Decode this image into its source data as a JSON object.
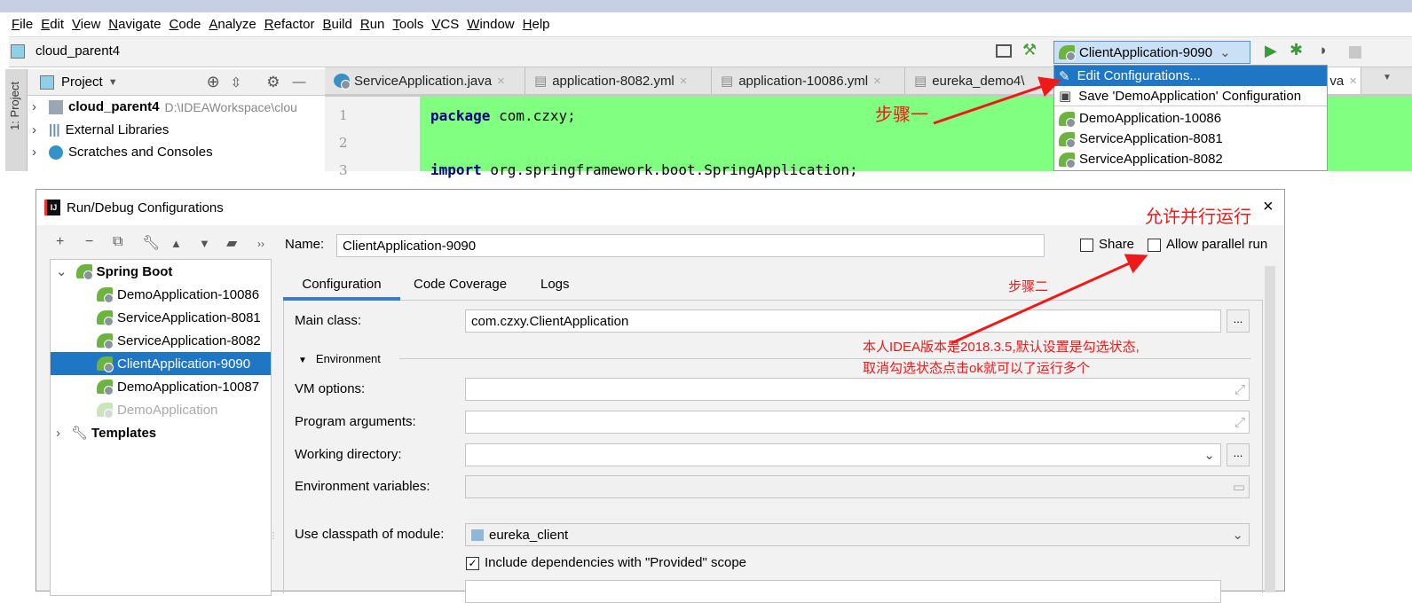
{
  "menu": [
    "File",
    "Edit",
    "View",
    "Navigate",
    "Code",
    "Analyze",
    "Refactor",
    "Build",
    "Run",
    "Tools",
    "VCS",
    "Window",
    "Help"
  ],
  "project_name": "cloud_parent4",
  "run_config": {
    "selected": "ClientApplication-9090"
  },
  "side_tab": "1: Project",
  "project_panel": {
    "title": "Project",
    "items": [
      {
        "name": "cloud_parent4",
        "path": "D:\\IDEAWorkspace\\clou"
      },
      {
        "name": "External Libraries"
      },
      {
        "name": "Scratches and Consoles"
      }
    ]
  },
  "editor_tabs": [
    "ServiceApplication.java",
    "application-8082.yml",
    "application-10086.yml",
    "eureka_demo4\\",
    "va"
  ],
  "code_lines": [
    {
      "num": "1",
      "keyword": "package",
      "text": " com.czxy;"
    },
    {
      "num": "2",
      "keyword": "",
      "text": ""
    },
    {
      "num": "3",
      "keyword": "import",
      "text": " org.springframework.boot.SpringApplication;"
    }
  ],
  "popup": {
    "items": [
      "Edit Configurations...",
      "Save 'DemoApplication' Configuration",
      "DemoApplication-10086",
      "ServiceApplication-8081",
      "ServiceApplication-8082"
    ]
  },
  "dialog": {
    "title": "Run/Debug Configurations",
    "name_label": "Name:",
    "name_value": "ClientApplication-9090",
    "share": "Share",
    "allow_parallel": "Allow parallel run",
    "share_checked": false,
    "allow_parallel_checked": false,
    "tree": {
      "root": "Spring Boot",
      "items": [
        "DemoApplication-10086",
        "ServiceApplication-8081",
        "ServiceApplication-8082",
        "ClientApplication-9090",
        "DemoApplication-10087",
        "DemoApplication"
      ],
      "selected": "ClientApplication-9090",
      "templates": "Templates"
    },
    "tabs": [
      "Configuration",
      "Code Coverage",
      "Logs"
    ],
    "active_tab": "Configuration",
    "fields": {
      "main_class_label": "Main class:",
      "main_class": "com.czxy.ClientApplication",
      "environment": "Environment",
      "vm_options": "VM options:",
      "program_args": "Program arguments:",
      "working_dir": "Working directory:",
      "env_vars": "Environment variables:",
      "classpath_label": "Use classpath of module:",
      "classpath_value": "eureka_client",
      "include_deps": "Include dependencies with \"Provided\" scope",
      "include_deps_checked": true,
      "dots": "..."
    }
  },
  "annotations": {
    "step1": "步骤一",
    "step2": "步骤二",
    "allow": "允许并行运行",
    "note1": "本人IDEA版本是2018.3.5,默认设置是勾选状态,",
    "note2": "取消勾选状态点击ok就可以了运行多个"
  },
  "colors": {
    "selection": "#1e76c4",
    "editor_bg": "#80ff80",
    "annotation": "#f01818",
    "spring": "#6db33f"
  }
}
